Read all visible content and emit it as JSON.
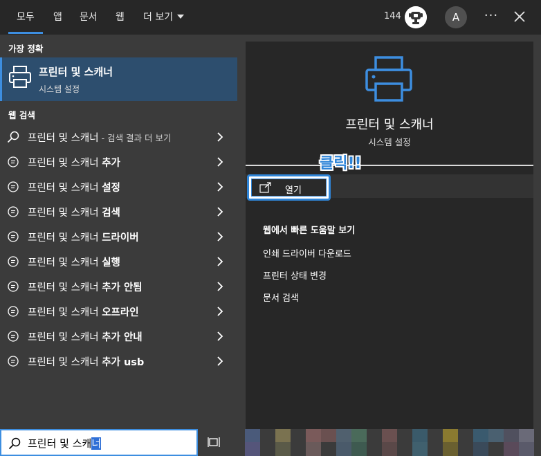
{
  "tabs": [
    {
      "label": "모두",
      "active": true
    },
    {
      "label": "앱"
    },
    {
      "label": "문서"
    },
    {
      "label": "웹"
    },
    {
      "label": "더 보기"
    }
  ],
  "header": {
    "points": "144",
    "avatar_initial": "A",
    "more": "···"
  },
  "left": {
    "best_match_label": "가장 정확",
    "best_match": {
      "title": "프린터 및 스캐너",
      "subtitle": "시스템 설정"
    },
    "web_search_label": "웹 검색",
    "web_items": [
      {
        "prefix": "프린터 및 스캐너",
        "suffix": " - 검색 결과 더 보기",
        "icon": "search-icon"
      },
      {
        "prefix": "프린터 및 스캐너 ",
        "bold": "추가",
        "icon": "web-search-icon"
      },
      {
        "prefix": "프린터 및 스캐너 ",
        "bold": "설정",
        "icon": "web-search-icon"
      },
      {
        "prefix": "프린터 및 스캐너 ",
        "bold": "검색",
        "icon": "web-search-icon"
      },
      {
        "prefix": "프린터 및 스캐너 ",
        "bold": "드라이버",
        "icon": "web-search-icon"
      },
      {
        "prefix": "프린터 및 스캐너 ",
        "bold": "실행",
        "icon": "web-search-icon"
      },
      {
        "prefix": "프린터 및 스캐너 ",
        "bold": "추가 안됨",
        "icon": "web-search-icon"
      },
      {
        "prefix": "프린터 및 스캐너 ",
        "bold": "오프라인",
        "icon": "web-search-icon"
      },
      {
        "prefix": "프린터 및 스캐너 ",
        "bold": "추가 안내",
        "icon": "web-search-icon"
      },
      {
        "prefix": "프린터 및 스캐너 ",
        "bold": "추가 usb",
        "icon": "web-search-icon"
      }
    ]
  },
  "right": {
    "title": "프린터 및 스캐너",
    "subtitle": "시스템 설정",
    "open_label": "열기",
    "annotation": "클릭!!",
    "help_title": "웹에서 빠른 도움말 보기",
    "help_links": [
      "인쇄 드라이버 다운로드",
      "프린터 상태 변경",
      "문서 검색"
    ]
  },
  "search": {
    "typed": "프린터 및 스캐",
    "selected": "너"
  },
  "colors": {
    "accent": "#3d8ee0",
    "best_match_bg": "#2d4e6e",
    "panel_bg": "#3b3b3b",
    "card_bg": "#272727"
  }
}
